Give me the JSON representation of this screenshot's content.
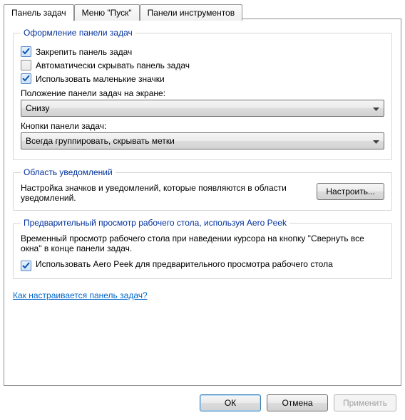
{
  "tabs": {
    "taskbar": "Панель задач",
    "start": "Меню \"Пуск\"",
    "toolbars": "Панели инструментов"
  },
  "group_appearance": {
    "legend": "Оформление панели задач",
    "lock": "Закрепить панель задач",
    "autohide": "Автоматически скрывать панель задач",
    "smallicons": "Использовать маленькие значки",
    "position_label": "Положение панели задач на экране:",
    "position_value": "Снизу",
    "buttons_label": "Кнопки панели задач:",
    "buttons_value": "Всегда группировать, скрывать метки"
  },
  "group_notif": {
    "legend": "Область уведомлений",
    "text": "Настройка значков и уведомлений, которые появляются в области уведомлений.",
    "btn": "Настроить..."
  },
  "group_aero": {
    "legend": "Предварительный просмотр рабочего стола, используя Aero Peek",
    "text": "Временный просмотр рабочего стола при наведении курсора на кнопку \"Свернуть все окна\" в конце панели задач.",
    "check": "Использовать Aero Peek для предварительного просмотра рабочего стола"
  },
  "help_link": "Как настраивается панель задач?",
  "buttons": {
    "ok": "ОК",
    "cancel": "Отмена",
    "apply": "Применить"
  }
}
